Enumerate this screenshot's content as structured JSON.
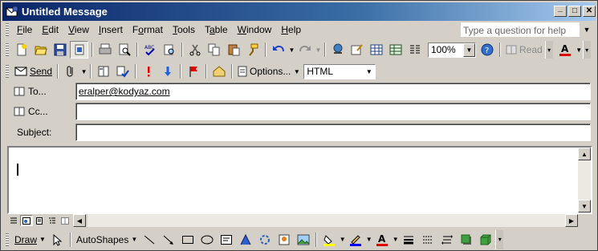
{
  "window": {
    "title": "Untitled Message",
    "minimize_glyph": "_",
    "maximize_glyph": "□",
    "close_glyph": "✕"
  },
  "menu": {
    "items": [
      {
        "id": "file",
        "label": "File",
        "accel": "F",
        "rest": "ile"
      },
      {
        "id": "edit",
        "label": "Edit",
        "accel": "E",
        "rest": "dit"
      },
      {
        "id": "view",
        "label": "View",
        "accel": "V",
        "rest": "iew"
      },
      {
        "id": "insert",
        "label": "Insert",
        "accel": "I",
        "rest": "nsert"
      },
      {
        "id": "format",
        "label": "Format",
        "accel": "o",
        "pre": "F",
        "rest": "rmat"
      },
      {
        "id": "tools",
        "label": "Tools",
        "accel": "T",
        "rest": "ools"
      },
      {
        "id": "table",
        "label": "Table",
        "accel": "a",
        "pre": "T",
        "rest": "ble"
      },
      {
        "id": "window",
        "label": "Window",
        "accel": "W",
        "rest": "indow"
      },
      {
        "id": "help",
        "label": "Help",
        "accel": "H",
        "rest": "elp"
      }
    ],
    "help_placeholder": "Type a question for help"
  },
  "toolbar": {
    "zoom": "100%",
    "read_label": "Read"
  },
  "email_toolbar": {
    "send_label": "Send",
    "options_label": "Options...",
    "format": "HTML"
  },
  "header": {
    "to_label": "To...",
    "to_value": "eralper@kodyaz.com",
    "cc_label": "Cc...",
    "cc_value": "",
    "subject_label": "Subject:",
    "subject_value": ""
  },
  "drawing": {
    "draw_label": "Draw",
    "autoshapes_label": "AutoShapes"
  },
  "colors": {
    "title_start": "#0a246a",
    "title_end": "#a6caf0",
    "font_color": "#e00000",
    "highlight": "#ffff00",
    "fill": "#ffff00",
    "line": "#0000ff"
  }
}
